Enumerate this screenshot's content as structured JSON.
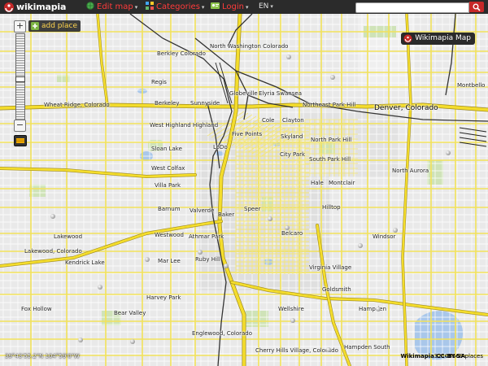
{
  "topbar": {
    "logo_text": "wikimapia",
    "edit_map": "Edit map",
    "categories": "Categories",
    "login": "Login",
    "language": "EN",
    "search_placeholder": ""
  },
  "map_controls": {
    "add_place": "add place",
    "layer_button": "Wikimapia Map",
    "zoom_level_fraction": 0.52
  },
  "labels": [
    {
      "text": "North Washington Colorado",
      "name": "label-north-washington"
    },
    {
      "text": "Berkley Colorado",
      "name": "label-berkley-colorado"
    },
    {
      "text": "Regis",
      "name": "label-regis"
    },
    {
      "text": "Wheat Ridge, Colorado",
      "name": "label-wheat-ridge"
    },
    {
      "text": "Berkeley",
      "name": "label-berkeley"
    },
    {
      "text": "Sunnyside",
      "name": "label-sunnyside"
    },
    {
      "text": "Globeville",
      "name": "label-globeville"
    },
    {
      "text": "Elyria Swansea",
      "name": "label-elyria-swansea"
    },
    {
      "text": "Northeast Park Hill",
      "name": "label-northeast-park-hill"
    },
    {
      "text": "Denver, Colorado",
      "name": "label-denver"
    },
    {
      "text": "Montbello",
      "name": "label-montbello"
    },
    {
      "text": "West Highland",
      "name": "label-west-highland"
    },
    {
      "text": "Highland",
      "name": "label-highland"
    },
    {
      "text": "Cole",
      "name": "label-cole"
    },
    {
      "text": "Clayton",
      "name": "label-clayton"
    },
    {
      "text": "Five Points",
      "name": "label-five-points"
    },
    {
      "text": "Skyland",
      "name": "label-skyland"
    },
    {
      "text": "North Park Hill",
      "name": "label-north-park-hill"
    },
    {
      "text": "Sloan Lake",
      "name": "label-sloan-lake"
    },
    {
      "text": "LoDo",
      "name": "label-lodo"
    },
    {
      "text": "City Park",
      "name": "label-city-park"
    },
    {
      "text": "South Park Hill",
      "name": "label-south-park-hill"
    },
    {
      "text": "West Colfax",
      "name": "label-west-colfax"
    },
    {
      "text": "North Aurora",
      "name": "label-north-aurora"
    },
    {
      "text": "Villa Park",
      "name": "label-villa-park"
    },
    {
      "text": "Hale",
      "name": "label-hale"
    },
    {
      "text": "Montclair",
      "name": "label-montclair"
    },
    {
      "text": "Barnum",
      "name": "label-barnum"
    },
    {
      "text": "Valverde",
      "name": "label-valverde"
    },
    {
      "text": "Baker",
      "name": "label-baker"
    },
    {
      "text": "Speer",
      "name": "label-speer"
    },
    {
      "text": "Hilltop",
      "name": "label-hilltop"
    },
    {
      "text": "Lakewood",
      "name": "label-lakewood"
    },
    {
      "text": "Westwood",
      "name": "label-westwood"
    },
    {
      "text": "Athmar Park",
      "name": "label-athmar-park"
    },
    {
      "text": "Belcaro",
      "name": "label-belcaro"
    },
    {
      "text": "Windsor",
      "name": "label-windsor"
    },
    {
      "text": "Lakewood, Colorado",
      "name": "label-lakewood-colorado"
    },
    {
      "text": "Kendrick Lake",
      "name": "label-kendrick-lake"
    },
    {
      "text": "Mar Lee",
      "name": "label-mar-lee"
    },
    {
      "text": "Ruby Hill",
      "name": "label-ruby-hill"
    },
    {
      "text": "Virginia Village",
      "name": "label-virginia-village"
    },
    {
      "text": "Goldsmith",
      "name": "label-goldsmith"
    },
    {
      "text": "Harvey Park",
      "name": "label-harvey-park"
    },
    {
      "text": "Fox Hollow",
      "name": "label-fox-hollow"
    },
    {
      "text": "Bear Valley",
      "name": "label-bear-valley"
    },
    {
      "text": "Wellshire",
      "name": "label-wellshire"
    },
    {
      "text": "Hampden",
      "name": "label-hampden"
    },
    {
      "text": "Englewood, Colorado",
      "name": "label-englewood"
    },
    {
      "text": "Hampden South",
      "name": "label-hampden-south"
    },
    {
      "text": "Cherry Hills Village, Colorado",
      "name": "label-cherry-hills-village"
    }
  ],
  "status": {
    "coordinates": "39°43'55.2\"N 104°59'0\"W",
    "credit": "Wikimapia CC-BY-SA",
    "places_count": "32108169 places"
  },
  "colors": {
    "topbar": "#2b2b2b",
    "road": "#f5e35a",
    "highway": "#f1d62c",
    "rail": "#333333",
    "water": "#a9c7ea",
    "park": "#cfe3b8",
    "brand_red": "#c62828"
  }
}
